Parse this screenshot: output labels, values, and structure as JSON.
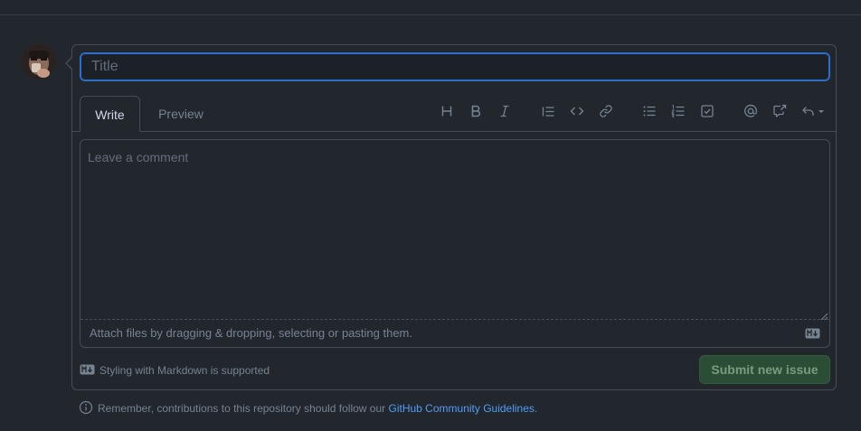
{
  "form": {
    "title_placeholder": "Title",
    "title_value": "",
    "tabs": [
      {
        "label": "Write",
        "active": true
      },
      {
        "label": "Preview",
        "active": false
      }
    ],
    "toolbar": [
      {
        "name": "heading-icon",
        "label": "H"
      },
      {
        "name": "bold-icon",
        "label": "B"
      },
      {
        "name": "italic-icon",
        "label": "I"
      },
      {
        "name": "quote-icon"
      },
      {
        "name": "code-icon"
      },
      {
        "name": "link-icon"
      },
      {
        "name": "unordered-list-icon"
      },
      {
        "name": "ordered-list-icon"
      },
      {
        "name": "task-list-icon"
      },
      {
        "name": "mention-icon"
      },
      {
        "name": "cross-reference-icon"
      },
      {
        "name": "reply-dropdown-icon"
      }
    ],
    "comment_placeholder": "Leave a comment",
    "comment_value": "",
    "attach_text": "Attach files by dragging & dropping, selecting or pasting them.",
    "markdown_hint": "Styling with Markdown is supported",
    "submit_label": "Submit new issue"
  },
  "footer": {
    "prefix": "Remember, contributions to this repository should follow our ",
    "link_text": "GitHub Community Guidelines",
    "suffix": "."
  },
  "colors": {
    "background": "#22272e",
    "border": "#444c56",
    "accent_blue": "#316dca",
    "link": "#539bf5",
    "submit_bg_disabled": "#2b4c35",
    "muted_text": "#768390"
  }
}
